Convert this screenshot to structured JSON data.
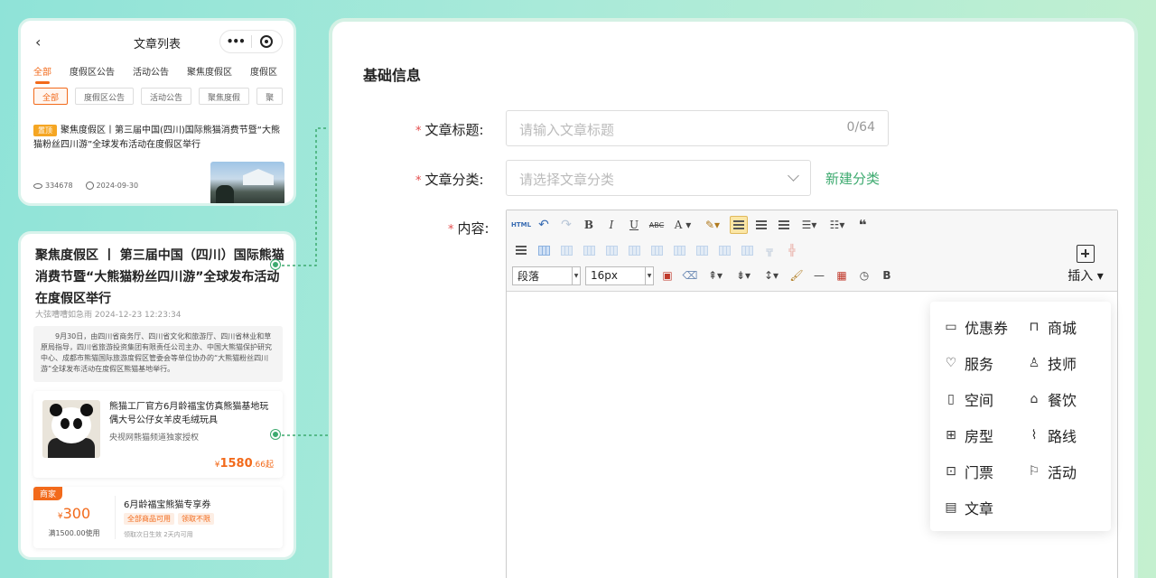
{
  "phone_list": {
    "nav": {
      "back_icon": "chevron-left-icon",
      "title": "文章列表",
      "more": "•••"
    },
    "tabs": [
      "全部",
      "度假区公告",
      "活动公告",
      "聚焦度假区",
      "度假区"
    ],
    "chips": [
      "全部",
      "度假区公告",
      "活动公告",
      "聚焦度假",
      "聚"
    ],
    "article": {
      "badge": "置顶",
      "title": "聚焦度假区丨第三届中国(四川)国际熊猫消费节暨“大熊猫粉丝四川游”全球发布活动在度假区举行",
      "views": "334678",
      "date": "2024-09-30"
    }
  },
  "phone_detail": {
    "title": "聚焦度假区 丨 第三届中国（四川）国际熊猫消费节暨“大熊猫粉丝四川游”全球发布活动在度假区举行",
    "author_line": "大弦嘈嘈如急雨   2024-12-23 12:23:34",
    "summary": "9月30日，由四川省商务厅、四川省文化和旅游厅、四川省林业和草原局指导，四川省旅游投资集团有限责任公司主办、中国大熊猫保护研究中心、成都市熊猫国际旅游度假区管委会等单位协办的“大熊猫粉丝四川游”全球发布活动在度假区熊猫基地举行。",
    "product": {
      "name": "熊猫工厂官方6月龄福宝仿真熊猫基地玩偶大号公仔女羊皮毛绒玩具",
      "source": "央视网熊猫频道独家授权",
      "price_symbol": "¥",
      "price": "1580",
      "price_decimal": ".66",
      "price_suffix": "起"
    },
    "coupon": {
      "tag": "商家",
      "symbol": "¥",
      "amount": "300",
      "condition": "满1500.00使用",
      "name": "6月龄福宝熊猫专享券",
      "tags": [
        "全部商品可用",
        "领取不限"
      ],
      "validity": "领取次日生效 2天内可用"
    }
  },
  "form": {
    "section_title": "基础信息",
    "title_label": "文章标题:",
    "title_placeholder": "请输入文章标题",
    "title_count": "0/64",
    "category_label": "文章分类:",
    "category_placeholder": "请选择文章分类",
    "new_category": "新建分类",
    "content_label": "内容:",
    "required_mark": "*"
  },
  "editor": {
    "paragraph_select": "段落",
    "fontsize_select": "16px",
    "insert_label": "插入",
    "insert_menu": [
      {
        "label": "优惠券",
        "icon": "ticket-icon"
      },
      {
        "label": "商城",
        "icon": "shopping-bag-icon"
      },
      {
        "label": "服务",
        "icon": "heart-icon"
      },
      {
        "label": "技师",
        "icon": "person-icon"
      },
      {
        "label": "空间",
        "icon": "door-icon"
      },
      {
        "label": "餐饮",
        "icon": "food-cover-icon"
      },
      {
        "label": "房型",
        "icon": "room-icon"
      },
      {
        "label": "路线",
        "icon": "route-icon"
      },
      {
        "label": "门票",
        "icon": "admission-ticket-icon"
      },
      {
        "label": "活动",
        "icon": "flag-icon"
      },
      {
        "label": "文章",
        "icon": "article-icon"
      }
    ]
  },
  "colors": {
    "accent_green": "#3daa6f",
    "accent_orange": "#f26a1b",
    "required_red": "#e34d4d"
  }
}
